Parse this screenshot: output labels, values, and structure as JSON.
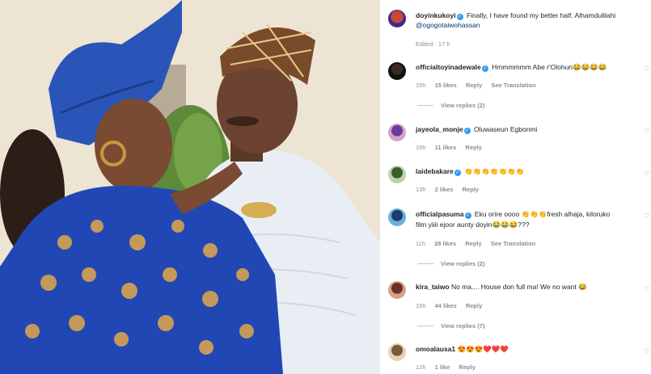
{
  "caption": {
    "username": "doyinkukoyi",
    "text": "Finally, I have found my better half. Alhamdulilahi",
    "mention": "@ogogotaiwohassan",
    "meta": "Edited · 17 h"
  },
  "comments": [
    {
      "username": "officialtoyinadewale",
      "text": "Hmmmmmm Abe r'Olohun😂😂😂😂",
      "time": "15h",
      "likes": "15 likes",
      "reply": "Reply",
      "translate": "See Translation",
      "view_replies": "View replies (2)"
    },
    {
      "username": "jayeola_monje",
      "text": "Oluwaseun Egbonmi",
      "time": "16h",
      "likes": "11 likes",
      "reply": "Reply"
    },
    {
      "username": "laidebakare",
      "text": "👏👏👏👏👏👏👏",
      "time": "13h",
      "likes": "2 likes",
      "reply": "Reply"
    },
    {
      "username": "officialpasuma",
      "text": "Eku orire oooo 👏👏👏fresh alhaja, kiloruko",
      "text2": "film yiiii ejoor aunty doyin😂😂😂???",
      "time": "11h",
      "likes": "28 likes",
      "reply": "Reply",
      "translate": "See Translation",
      "view_replies": "View replies (2)"
    },
    {
      "username": "kira_taiwo",
      "text": "No ma.... House don full ma! We no want 😂",
      "time": "15h",
      "likes": "44 likes",
      "reply": "Reply",
      "view_replies": "View replies (7)"
    },
    {
      "username": "omoalausa1",
      "text": "😍😍😍❤️❤️❤️",
      "time": "12h",
      "likes": "1 like",
      "reply": "Reply"
    }
  ],
  "icons": {
    "verified": "verified-badge-icon",
    "like": "heart-icon"
  },
  "colors": {
    "verified": "#3897f0",
    "link": "#00376b",
    "meta": "#8e8e8e"
  }
}
